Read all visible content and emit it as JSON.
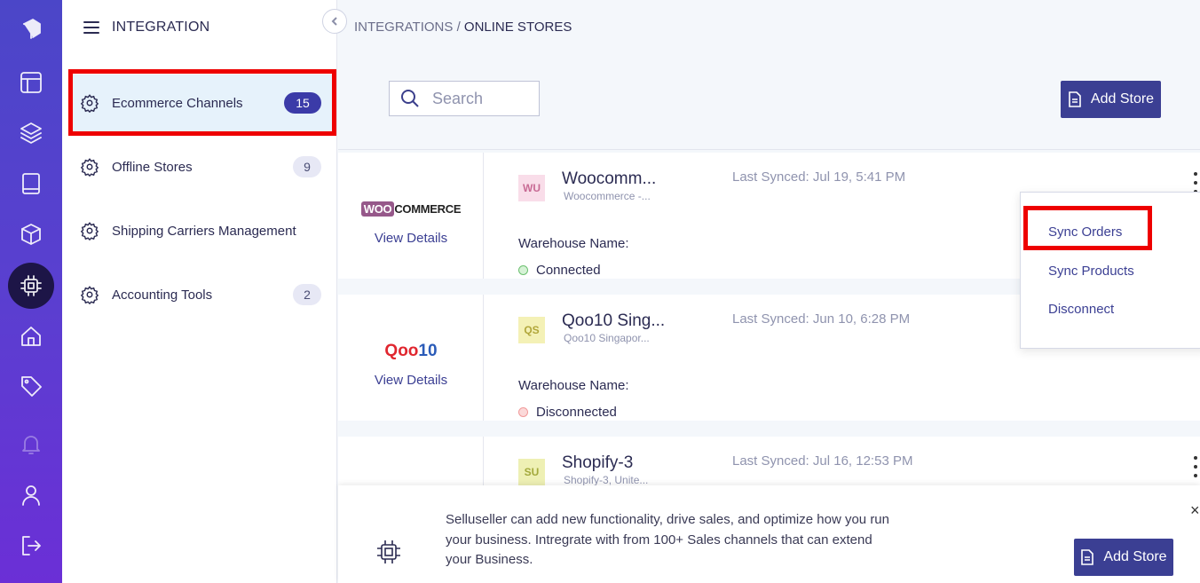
{
  "rail": {
    "icons": [
      "brand-logo-icon",
      "layout-icon",
      "layers-icon",
      "book-icon",
      "package-icon",
      "integration-chip-icon",
      "home-icon",
      "tag-icon",
      "bell-icon",
      "user-icon",
      "logout-icon"
    ]
  },
  "sidebar": {
    "title": "INTEGRATION",
    "items": [
      {
        "label": "Ecommerce Channels",
        "count": "15"
      },
      {
        "label": "Offline Stores",
        "count": "9"
      },
      {
        "label": "Shipping Carriers Management",
        "count": ""
      },
      {
        "label": "Accounting Tools",
        "count": "2"
      }
    ]
  },
  "breadcrumb": {
    "parent": "INTEGRATIONS",
    "separator": " / ",
    "current": "ONLINE STORES"
  },
  "search": {
    "placeholder": "Search"
  },
  "toolbar": {
    "add_store_label": "Add Store"
  },
  "stores": [
    {
      "logo_text_a": "WOO",
      "logo_text_b": "COMMERCE",
      "view_details": "View Details",
      "avatar": "WU",
      "name": "Woocomm...",
      "subtitle": "Woocommerce -...",
      "last_synced": "Last Synced: Jul 19, 5:41 PM",
      "warehouse_label": "Warehouse Name:",
      "status": "Connected"
    },
    {
      "logo_text_a": "Qoo",
      "logo_text_b": "10",
      "view_details": "View Details",
      "avatar": "QS",
      "name": "Qoo10 Sing...",
      "subtitle": "Qoo10 Singapor...",
      "last_synced": "Last Synced: Jun 10, 6:28 PM",
      "warehouse_label": "Warehouse Name:",
      "status": "Disconnected"
    },
    {
      "avatar": "SU",
      "name": "Shopify-3",
      "subtitle": "Shopify-3, Unite...",
      "last_synced": "Last Synced: Jul 16, 12:53 PM"
    }
  ],
  "dropdown": {
    "items": [
      "Sync Orders",
      "Sync Products",
      "Disconnect"
    ]
  },
  "banner": {
    "text": "Selluseller can add new functionality, drive sales, and optimize how you run your business. Intregrate with from 100+ Sales channels that can extend your Business.",
    "button_label": "Add Store",
    "close": "×"
  },
  "colors": {
    "accent": "#3b3f93",
    "highlight": "#ee0000",
    "connected": "#6cc070",
    "disconnected": "#f19a9a"
  }
}
